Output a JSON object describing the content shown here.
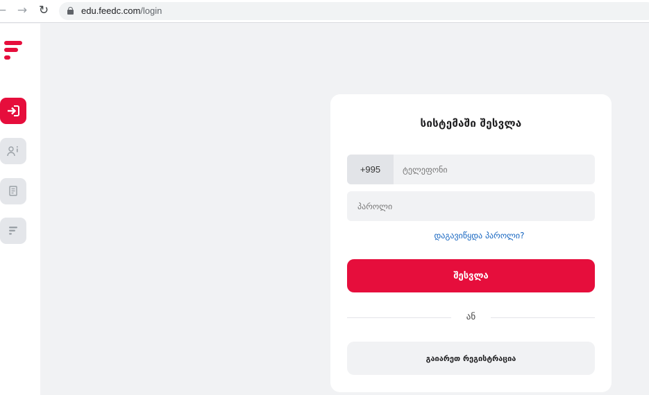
{
  "browser": {
    "url_host": "edu.feedc.com",
    "url_path": "/login",
    "back_icon": "arrow-left-icon",
    "forward_icon": "arrow-right-icon",
    "reload_icon": "reload-icon"
  },
  "sidebar": {
    "logo": "feedc-logo",
    "items": [
      {
        "icon": "login-icon",
        "active": true
      },
      {
        "icon": "user-info-icon",
        "active": false
      },
      {
        "icon": "document-icon",
        "active": false
      },
      {
        "icon": "feedc-icon",
        "active": false
      }
    ]
  },
  "login": {
    "title": "სისტემაში შესვლა",
    "country_code": "+995",
    "phone_placeholder": "ტელეფონი",
    "password_placeholder": "პაროლი",
    "forgot_password": "დაგავიწყდა პაროლი?",
    "submit_label": "შესვლა",
    "or_label": "ან",
    "register_label": "გაიარეთ რეგისტრაცია"
  },
  "colors": {
    "brand": "#e60e3c",
    "link": "#1565c0",
    "background": "#f1f2f4"
  }
}
